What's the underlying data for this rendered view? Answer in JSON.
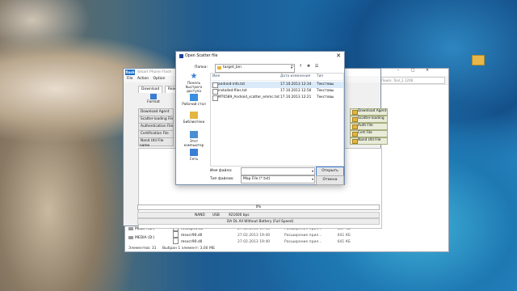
{
  "desktop": {
    "icon_label": ""
  },
  "explorer": {
    "search_placeholder": "Поиск: Tool_2.1208",
    "drives": [
      {
        "label": "MEDIA (D:)"
      },
      {
        "label": "MEDIA (D:)"
      }
    ],
    "files": [
      {
        "name": "msvcp90.dll",
        "date": "27.02.2013 19:40",
        "type": "Расширение прил...",
        "size": "557 КБ"
      },
      {
        "name": "msvcr90.dll",
        "date": "27.02.2013 19:40",
        "type": "Расширение прил...",
        "size": "641 КБ"
      },
      {
        "name": "msvcr90.dll",
        "date": "27.02.2013 19:40",
        "type": "Расширение прил...",
        "size": "641 КБ"
      }
    ],
    "status": {
      "items": "Элементов: 31",
      "selected": "Выбран 1 элемент: 3,00 МБ"
    }
  },
  "flashtool": {
    "logo": "flash",
    "title": "Smart Phone Flash",
    "menu": [
      "File",
      "Action",
      "Option"
    ],
    "tabs": [
      "Download",
      "Read back"
    ],
    "format_label": "Format",
    "left_buttons": [
      "Download Agent",
      "Scatter-loading File",
      "Authentication File",
      "Certification File",
      "Nand Util File"
    ],
    "right_buttons": [
      "Download Agent",
      "Scatter-loading",
      "Auth File",
      "Cert File",
      "Nand Util File"
    ],
    "name_col": "name",
    "progress": "0%",
    "status_bar": {
      "nand": "NAND",
      "usb": "USB",
      "speed": "921600 bps"
    },
    "status_bar2": "DA DL All Without Battery (Full Speed)"
  },
  "dialog": {
    "title": "Open Scatter file",
    "look_in_label": "Папка:",
    "look_in_value": "target_bin",
    "places": [
      {
        "label": "Панель быстрого доступа",
        "color": "#3a7fd4"
      },
      {
        "label": "Рабочий стол",
        "color": "#3a8ee0"
      },
      {
        "label": "Библиотеки",
        "color": "#e3b640"
      },
      {
        "label": "Этот компьютер",
        "color": "#4a90d0"
      },
      {
        "label": "Сеть",
        "color": "#3a7fd4"
      }
    ],
    "columns": {
      "name": "Имя",
      "date": "Дата изменения",
      "type": "Тип"
    },
    "files": [
      {
        "name": "android-info.txt",
        "date": "17.10.2013 12:34",
        "type": "Текстовы"
      },
      {
        "name": "installed-files.txt",
        "date": "17.10.2013 12:56",
        "type": "Текстовы"
      },
      {
        "name": "MT6589_Android_scatter_emmc.txt",
        "date": "17.10.2013 12:21",
        "type": "Текстовы"
      }
    ],
    "filename_label": "Имя файла:",
    "filename_value": "",
    "filetype_label": "Тип файлов:",
    "filetype_value": "Map File (*.txt)",
    "open_label": "Открыть",
    "cancel_label": "Отмена"
  }
}
